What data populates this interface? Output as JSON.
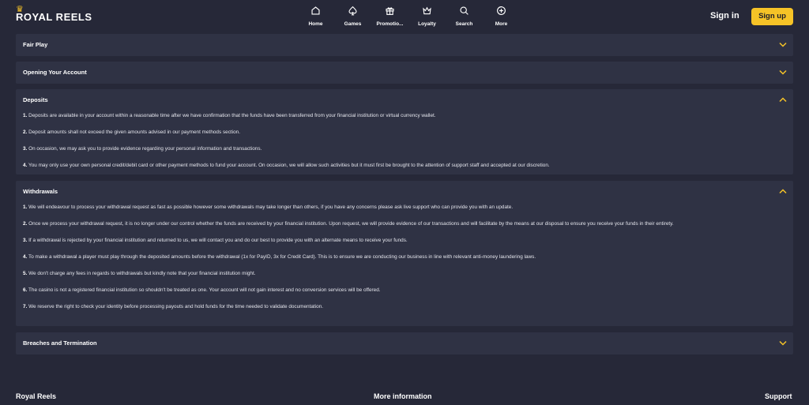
{
  "header": {
    "logo_text": "ROYAL REELS",
    "nav": [
      {
        "label": "Home",
        "icon": "home-icon"
      },
      {
        "label": "Games",
        "icon": "spade-icon"
      },
      {
        "label": "Promotio...",
        "icon": "gift-icon"
      },
      {
        "label": "Loyalty",
        "icon": "crown-icon"
      },
      {
        "label": "Search",
        "icon": "search-icon"
      },
      {
        "label": "More",
        "icon": "plus-circle-icon"
      }
    ],
    "signin_label": "Sign in",
    "signup_label": "Sign up"
  },
  "colors": {
    "accent": "#f6c327",
    "background": "#262838",
    "panel": "#2f3244"
  },
  "sections": [
    {
      "title": "Fair Play",
      "expanded": false
    },
    {
      "title": "Opening Your Account",
      "expanded": false
    },
    {
      "title": "Deposits",
      "expanded": true,
      "items": [
        {
          "num": "1.",
          "text": "Deposits are available in your account within a reasonable time after we have confirmation that the funds have been transferred from your financial institution or virtual currency wallet."
        },
        {
          "num": "2.",
          "text": "Deposit amounts shall not exceed the given amounts advised in our payment methods section."
        },
        {
          "num": "3.",
          "text": "On occasion, we may ask you to provide evidence regarding your personal information and transactions."
        },
        {
          "num": "4.",
          "text": "You may only use your own personal credit/debit card or other payment methods to fund your account. On occasion, we will allow such activities but it must first be brought to the attention of support staff and accepted at our discretion."
        }
      ]
    },
    {
      "title": "Withdrawals",
      "expanded": true,
      "items": [
        {
          "num": "1.",
          "text": "We will endeavour to process your withdrawal request as fast as possible however some withdrawals may take longer than others, if you have any concerns please ask live support who can provide you with an update."
        },
        {
          "num": "2.",
          "text": "Once we process your withdrawal request, it is no longer under our control whether the funds are received by your financial institution. Upon request, we will provide evidence of our transactions and will facilitate by the means at our disposal to ensure you receive your funds in their entirety."
        },
        {
          "num": "3.",
          "text": "If a withdrawal is rejected by your financial institution and returned to us, we will contact you and do our best to provide you with an alternate means to receive your funds."
        },
        {
          "num": "4.",
          "text": "To make a withdrawal a player must play through the deposited amounts before the withdrawal (1x for PayID, 3x for Credit Card). This is to ensure we are conducting our business in line with relevant anti-money laundering laws."
        },
        {
          "num": "5.",
          "text": "We don't charge any fees in regards to withdrawals but kindly note that your financial institution might."
        },
        {
          "num": "6.",
          "text": "The casino is not a registered financial institution so shouldn't be treated as one. Your account will not gain interest and no conversion services will be offered."
        },
        {
          "num": "7.",
          "text": "We reserve the right to check your identity before processing payouts and hold funds for the time needed to validate documentation."
        }
      ]
    },
    {
      "title": "Breaches and Termination",
      "expanded": false
    }
  ],
  "footer": {
    "col1": "Royal Reels",
    "col2": "More information",
    "col3": "Support"
  }
}
